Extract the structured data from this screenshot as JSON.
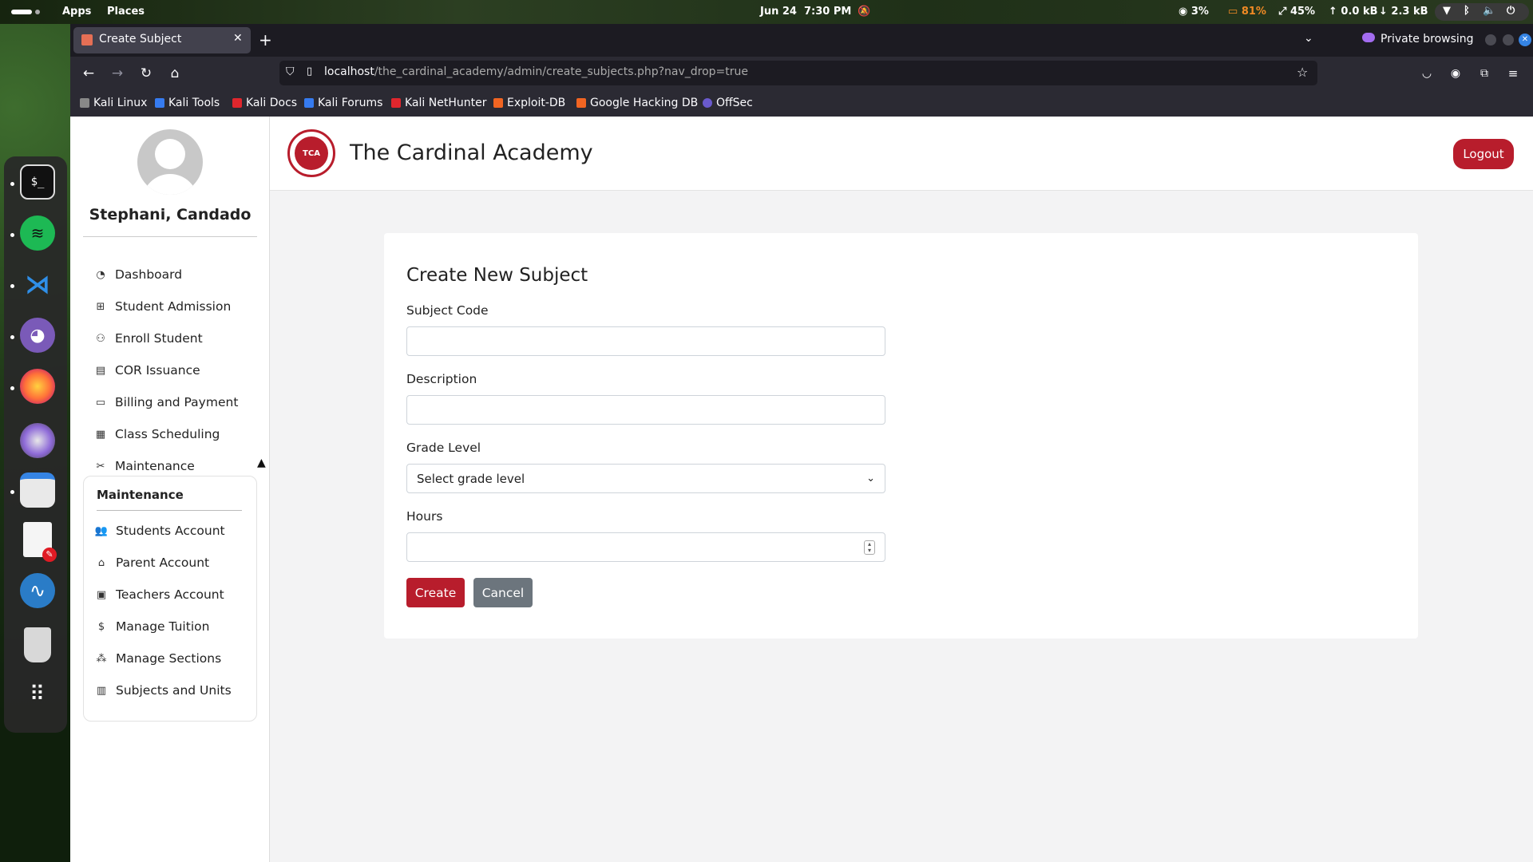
{
  "topbar": {
    "apps": "Apps",
    "places": "Places",
    "date": "Jun 24",
    "time": "7:30 PM",
    "cpu": "3%",
    "battery": "81%",
    "memory": "45%",
    "net_up": "0.0 kB",
    "net_down": "2.3 kB"
  },
  "browser": {
    "tab_title": "Create Subject",
    "private_label": "Private browsing",
    "url_host": "localhost",
    "url_path": "/the_cardinal_academy/admin/create_subjects.php?nav_drop=true",
    "bookmarks": [
      "Kali Linux",
      "Kali Tools",
      "Kali Docs",
      "Kali Forums",
      "Kali NetHunter",
      "Exploit-DB",
      "Google Hacking DB",
      "OffSec"
    ]
  },
  "sidebar": {
    "user_name": "Stephani, Candado",
    "items": [
      {
        "label": "Dashboard",
        "icon": "dashboard-icon"
      },
      {
        "label": "Student Admission",
        "icon": "admission-icon"
      },
      {
        "label": "Enroll Student",
        "icon": "enroll-icon"
      },
      {
        "label": "COR Issuance",
        "icon": "document-icon"
      },
      {
        "label": "Billing and Payment",
        "icon": "billing-icon"
      },
      {
        "label": "Class Scheduling",
        "icon": "calendar-icon"
      },
      {
        "label": "Maintenance",
        "icon": "tools-icon"
      }
    ],
    "maintenance": {
      "title": "Maintenance",
      "items": [
        {
          "label": "Students Account",
          "icon": "people-icon"
        },
        {
          "label": "Parent Account",
          "icon": "parent-icon"
        },
        {
          "label": "Teachers Account",
          "icon": "teacher-icon"
        },
        {
          "label": "Manage Tuition",
          "icon": "dollar-icon"
        },
        {
          "label": "Manage Sections",
          "icon": "sections-icon"
        },
        {
          "label": "Subjects and Units",
          "icon": "book-icon"
        }
      ]
    }
  },
  "header": {
    "logo_text": "TCA",
    "site_title": "The Cardinal Academy",
    "logout_label": "Logout"
  },
  "form": {
    "title": "Create New Subject",
    "subject_code_label": "Subject Code",
    "subject_code_value": "",
    "description_label": "Description",
    "description_value": "",
    "grade_level_label": "Grade Level",
    "grade_level_selected": "Select grade level",
    "hours_label": "Hours",
    "hours_value": "",
    "create_label": "Create",
    "cancel_label": "Cancel"
  },
  "colors": {
    "brand_red": "#b81d2c",
    "cancel_gray": "#6c757d"
  }
}
